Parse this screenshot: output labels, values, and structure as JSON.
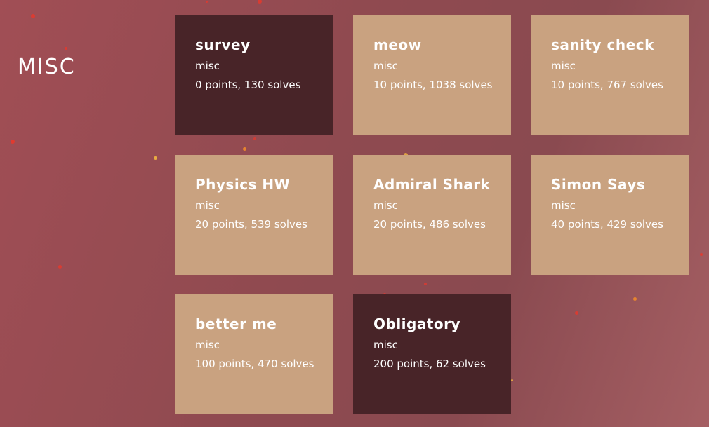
{
  "section": {
    "title": "MISC"
  },
  "colors": {
    "background": "#98494f",
    "card_unsolved": "#c9a280",
    "card_solved": "#482428",
    "text": "#ffffff",
    "particle_red": "#e8382b",
    "particle_orange": "#f08a2a",
    "particle_yellow": "#f2b640"
  },
  "challenges": [
    {
      "title": "survey",
      "category": "misc",
      "stats": "0 points, 130 solves",
      "solved": true
    },
    {
      "title": "meow",
      "category": "misc",
      "stats": "10 points, 1038 solves",
      "solved": false
    },
    {
      "title": "sanity check",
      "category": "misc",
      "stats": "10 points, 767 solves",
      "solved": false
    },
    {
      "title": "Physics HW",
      "category": "misc",
      "stats": "20 points, 539 solves",
      "solved": false
    },
    {
      "title": "Admiral Shark",
      "category": "misc",
      "stats": "20 points, 486 solves",
      "solved": false
    },
    {
      "title": "Simon Says",
      "category": "misc",
      "stats": "40 points, 429 solves",
      "solved": false
    },
    {
      "title": "better me",
      "category": "misc",
      "stats": "100 points, 470 solves",
      "solved": false
    },
    {
      "title": "Obligatory",
      "category": "misc",
      "stats": "200 points, 62 solves",
      "solved": true
    }
  ]
}
